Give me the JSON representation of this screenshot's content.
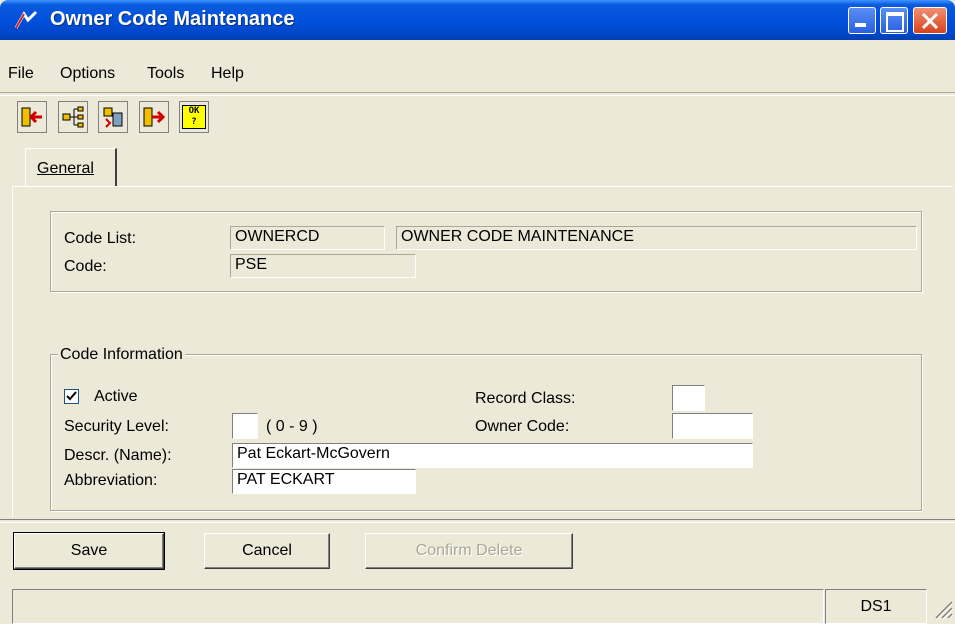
{
  "window": {
    "title": "Owner Code Maintenance",
    "title_color": "#0054e3"
  },
  "menu": [
    "File",
    "Options",
    "Tools",
    "Help"
  ],
  "toolbar": {
    "icons": [
      "exit-icon",
      "tree-icon",
      "records-icon",
      "logout-icon",
      "ok-help-icon"
    ],
    "ok_glyph": "OK"
  },
  "tabs": [
    {
      "label": "General",
      "active": true
    }
  ],
  "header": {
    "code_list_label": "Code List:",
    "code_list_value": "OWNERCD",
    "code_list_desc": "OWNER CODE MAINTENANCE",
    "code_label": "Code:",
    "code_value": "PSE"
  },
  "code_info": {
    "legend": "Code Information",
    "active_label": "Active",
    "active_checked": true,
    "security_level_label": "Security Level:",
    "security_level_value": "",
    "security_range": "( 0 - 9 )",
    "record_class_label": "Record Class:",
    "record_class_value": "",
    "owner_code_label": "Owner Code:",
    "owner_code_value": "",
    "descr_label": "Descr. (Name):",
    "descr_value": "Pat Eckart-McGovern",
    "abbrev_label": "Abbreviation:",
    "abbrev_value": "PAT ECKART"
  },
  "buttons": {
    "save": "Save",
    "cancel": "Cancel",
    "confirm_delete": "Confirm Delete"
  },
  "status": {
    "left": "",
    "right": "DS1"
  }
}
